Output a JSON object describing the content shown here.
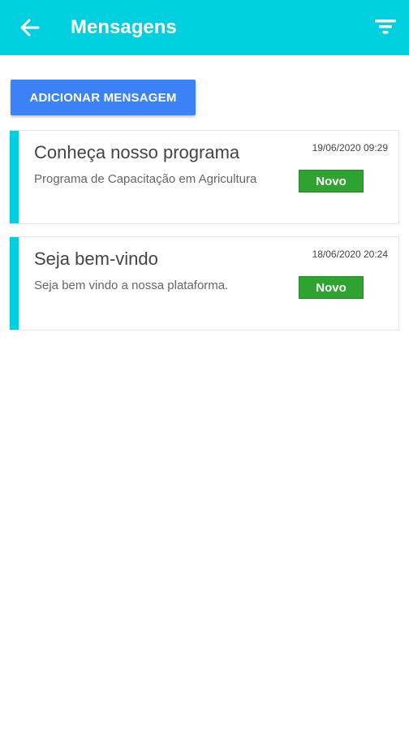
{
  "header": {
    "title": "Mensagens",
    "background_color": "#00cfdf",
    "back_icon": "arrow-left-icon",
    "filter_icon": "filter-icon"
  },
  "actions": {
    "add_label": "ADICIONAR MENSAGEM",
    "add_color": "#3b82f6"
  },
  "messages": [
    {
      "title": "Conheça nosso programa",
      "preview": "Programa de Capacitação em Agricultura",
      "datetime": "19/06/2020 09:29",
      "badge": "Novo"
    },
    {
      "title": "Seja bem-vindo",
      "preview": "Seja bem vindo a nossa plataforma.",
      "datetime": "18/06/2020 20:24",
      "badge": "Novo"
    }
  ],
  "colors": {
    "accent": "#00cfdf",
    "badge": "#2fa32f"
  }
}
